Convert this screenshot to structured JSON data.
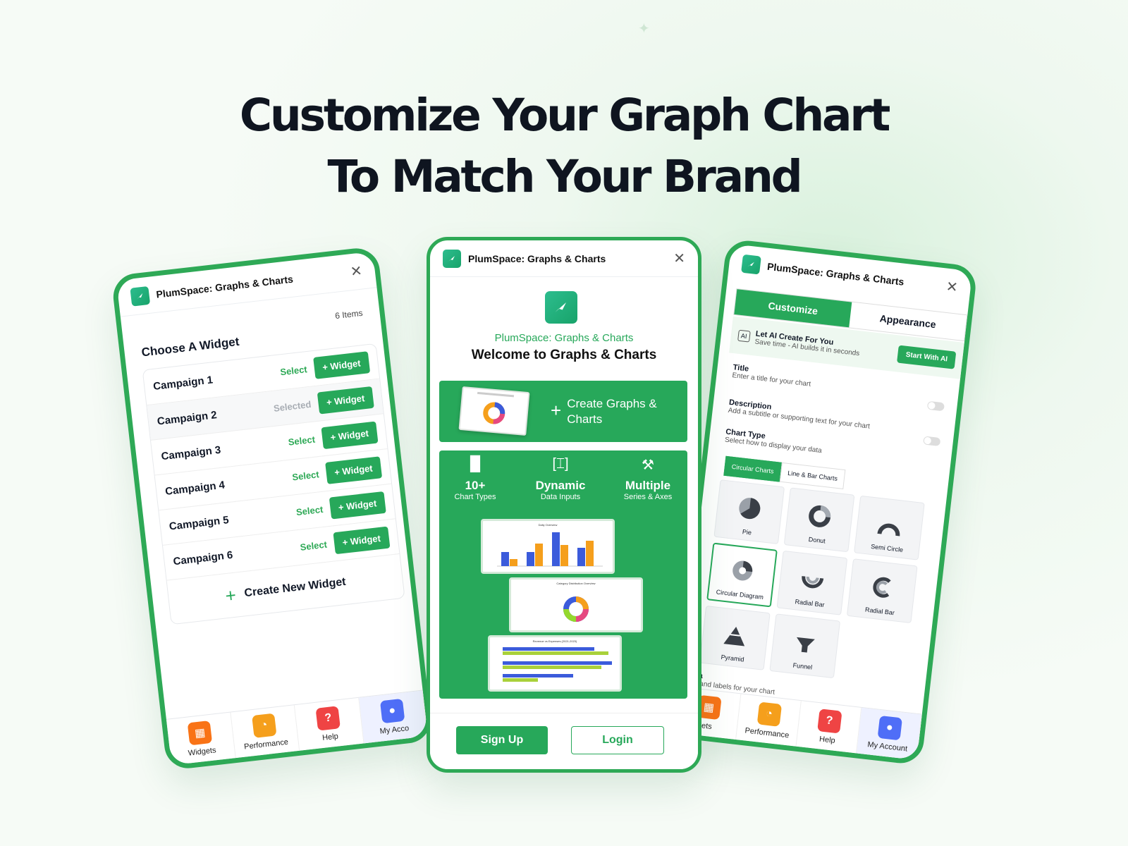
{
  "hero": {
    "line1": "Customize Your Graph Chart",
    "line2": "To Match Your Brand"
  },
  "app_title": "PlumSpace: Graphs & Charts",
  "left": {
    "section_title": "Choose A Widget",
    "count": "6 Items",
    "rows": [
      {
        "name": "Campaign 1",
        "select": "Select",
        "widget": "+ Widget"
      },
      {
        "name": "Campaign 2",
        "select": "Selected",
        "widget": "+ Widget"
      },
      {
        "name": "Campaign 3",
        "select": "Select",
        "widget": "+ Widget"
      },
      {
        "name": "Campaign 4",
        "select": "Select",
        "widget": "+ Widget"
      },
      {
        "name": "Campaign 5",
        "select": "Select",
        "widget": "+ Widget"
      },
      {
        "name": "Campaign 6",
        "select": "Select",
        "widget": "+ Widget"
      }
    ],
    "create": "Create New Widget",
    "nav": [
      "Widgets",
      "Performance",
      "Help",
      "My Acco"
    ]
  },
  "middle": {
    "subtitle": "PlumSpace: Graphs & Charts",
    "welcome": "Welcome to Graphs & Charts",
    "create": "Create Graphs & Charts",
    "features": [
      {
        "big": "10+",
        "small": "Chart Types"
      },
      {
        "big": "Dynamic",
        "small": "Data Inputs"
      },
      {
        "big": "Multiple",
        "small": "Series & Axes"
      }
    ],
    "mini_titles": [
      "Daily Overview",
      "Category Distribution Overview",
      "Revenue vs Expenses (2021-2023)"
    ],
    "signup": "Sign Up",
    "login": "Login"
  },
  "right": {
    "tab_customize": "Customize",
    "tab_appearance": "Appearance",
    "ai_title": "Let AI Create For You",
    "ai_desc": "Save time - AI builds it in seconds",
    "ai_button": "Start With AI",
    "title_label": "Title",
    "title_desc": "Enter a title for your chart",
    "desc_label": "Description",
    "desc_desc": "Add a subtitle or supporting text for your chart",
    "type_label": "Chart Type",
    "type_desc": "Select how to display your data",
    "subtab1": "Circular Charts",
    "subtab2": "Line & Bar Charts",
    "charts": [
      "Pie",
      "Donut",
      "Semi Circle",
      "Circular Diagram",
      "Radial Bar",
      "Radial Bar",
      "Pyramid",
      "Funnel"
    ],
    "data_label": "rt Data",
    "data_desc": " values and labels for your chart",
    "nav": [
      "ets",
      "Performance",
      "Help",
      "My Account"
    ]
  },
  "colors": {
    "brand": "#27a85a",
    "accent_blue": "#3b5bdb",
    "accent_orange": "#f59f1c"
  }
}
